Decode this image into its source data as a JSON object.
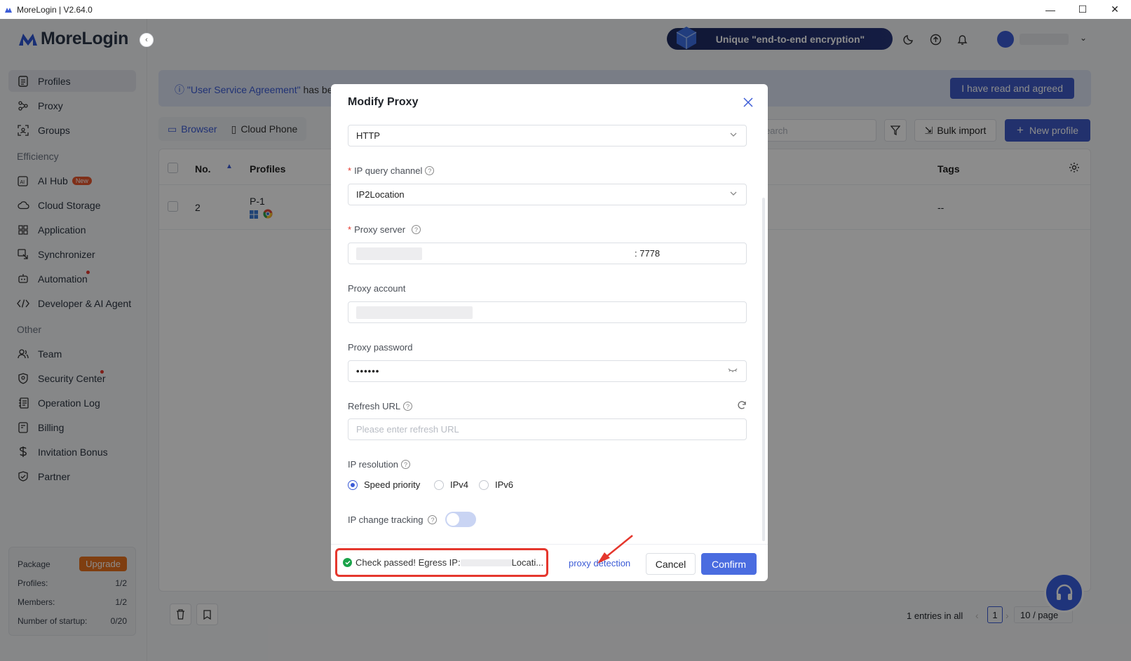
{
  "window": {
    "title": "MoreLogin | V2.64.0",
    "controls": {
      "minimize": "—",
      "maximize": "☐",
      "close": "✕"
    }
  },
  "brand": {
    "name": "MoreLogin"
  },
  "sidebar": {
    "items": [
      {
        "label": "Profiles",
        "icon": "profile-doc-icon",
        "active": true
      },
      {
        "label": "Proxy",
        "icon": "proxy-icon"
      }
    ],
    "groups_label": "Groups",
    "efficiency_label": "Efficiency",
    "efficiency": [
      {
        "label": "AI Hub",
        "badge": "New"
      },
      {
        "label": "Cloud Storage"
      },
      {
        "label": "Application"
      },
      {
        "label": "Synchronizer"
      },
      {
        "label": "Automation"
      },
      {
        "label": "Developer & AI Agent"
      }
    ],
    "other_label": "Other",
    "other": [
      {
        "label": "Team"
      },
      {
        "label": "Security Center"
      },
      {
        "label": "Operation Log"
      },
      {
        "label": "Billing"
      },
      {
        "label": "Invitation Bonus"
      },
      {
        "label": "Partner"
      }
    ],
    "package": {
      "label": "Package",
      "upgrade": "Upgrade",
      "rows": [
        {
          "k": "Profiles:",
          "v": "1/2"
        },
        {
          "k": "Members:",
          "v": "1/2"
        },
        {
          "k": "Number of startup:",
          "v": "0/20"
        }
      ]
    }
  },
  "header": {
    "promo": "Unique \"end-to-end encryption\"",
    "user_caret": "⌄"
  },
  "notice": {
    "link": "\"User Service Agreement\"",
    "text": " has bee",
    "agree": "I have read and agreed"
  },
  "tabs": [
    {
      "label": "Browser"
    },
    {
      "label": "Cloud Phone"
    }
  ],
  "toolbar": {
    "search_placeholder": "earch",
    "bulk_import": "Bulk import",
    "new_profile": "New profile"
  },
  "table": {
    "columns": {
      "no": "No.",
      "profiles": "Profiles",
      "tags": "Tags"
    },
    "rows": [
      {
        "no": "2",
        "name": "P-1",
        "tags": "--"
      }
    ]
  },
  "pagination": {
    "summary": "1 entries in all",
    "page": "1",
    "per_page": "10 / page"
  },
  "modal": {
    "title": "Modify Proxy",
    "protocol": "HTTP",
    "ip_channel_label": "IP query channel",
    "ip_channel_value": "IP2Location",
    "server_label": "Proxy server",
    "server_port": ": 7778",
    "account_label": "Proxy account",
    "password_label": "Proxy password",
    "password_value": "••••••",
    "refresh_label": "Refresh URL",
    "refresh_placeholder": "Please enter refresh URL",
    "resolution_label": "IP resolution",
    "resolution_options": [
      "Speed priority",
      "IPv4",
      "IPv6"
    ],
    "resolution_selected": "Speed priority",
    "tracking_label": "IP change tracking",
    "tracking_on": false,
    "check_prefix": "Check passed! Egress IP:",
    "check_suffix": " Locati...",
    "detect_link": "proxy detection",
    "cancel": "Cancel",
    "confirm": "Confirm"
  },
  "colors": {
    "accent": "#3b5bd6",
    "danger": "#e5372d",
    "success": "#1aa34a",
    "upgrade": "#e8711e"
  }
}
